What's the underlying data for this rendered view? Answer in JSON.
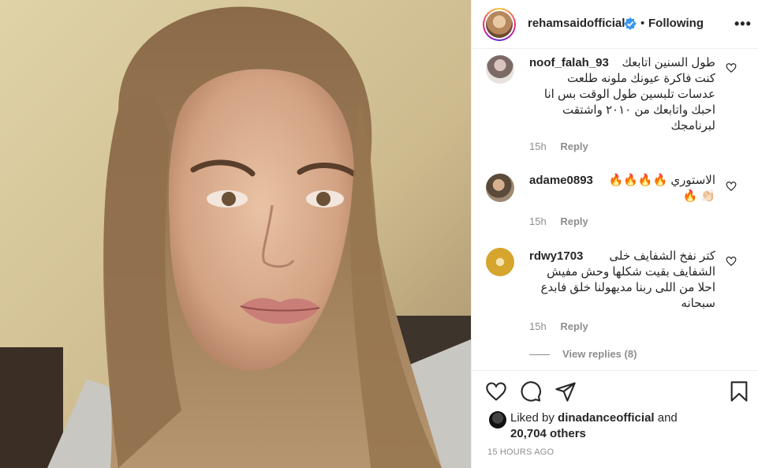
{
  "post": {
    "username": "rehamsaidofficial",
    "separator": "•",
    "follow_status": "Following",
    "more_label": "•••",
    "photo_alt": "selfie"
  },
  "comments": [
    {
      "username": "noof_falah_93",
      "text": "طول السنين اتابعك كنت فاكرة عيونك ملونه طلعت عدسات تلبسين طول الوقت بس انا احبك واتابعك من ٢٠١٠ واشتقت لبرنامجك",
      "time": "15h",
      "reply": "Reply"
    },
    {
      "username": "adame0893",
      "text": "الاستوري 🔥🔥🔥🔥👏🏻 🔥",
      "time": "15h",
      "reply": "Reply"
    },
    {
      "username": "rdwy1703",
      "text": "كتر نفخ الشفايف خلى الشفايف بقيت شكلها وحش مفيش احلا من اللى ربنا مديهولنا خلق فابدع سبحانه",
      "time": "15h",
      "reply": "Reply"
    }
  ],
  "view_replies": "View replies (8)",
  "likes": {
    "prefix": "Liked by ",
    "user": "dinadanceofficial",
    "middle": " and",
    "count": "20,704 others"
  },
  "timestamp": "15 HOURS AGO",
  "colors": {
    "verified": "#3897f0",
    "muted": "#8e8e8e",
    "text": "#262626"
  }
}
